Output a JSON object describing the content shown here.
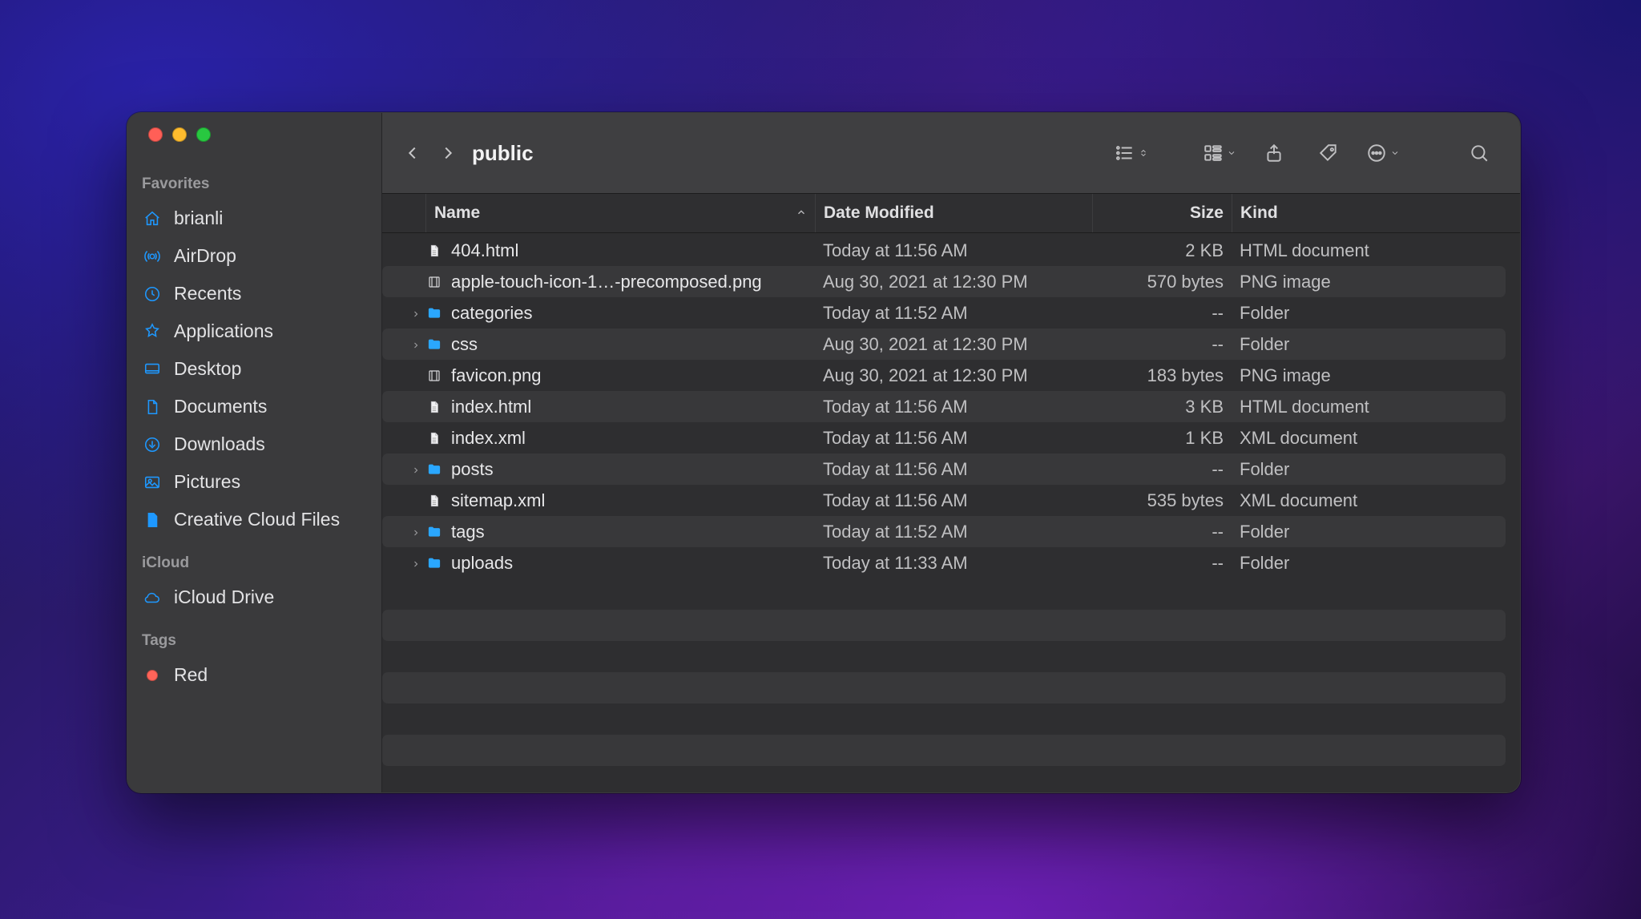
{
  "window": {
    "title": "public"
  },
  "sidebar": {
    "sections": [
      {
        "title": "Favorites",
        "items": [
          {
            "icon": "home",
            "label": "brianli"
          },
          {
            "icon": "airdrop",
            "label": "AirDrop"
          },
          {
            "icon": "clock",
            "label": "Recents"
          },
          {
            "icon": "apps",
            "label": "Applications"
          },
          {
            "icon": "desktop",
            "label": "Desktop"
          },
          {
            "icon": "doc",
            "label": "Documents"
          },
          {
            "icon": "download",
            "label": "Downloads"
          },
          {
            "icon": "pictures",
            "label": "Pictures"
          },
          {
            "icon": "file",
            "label": "Creative Cloud Files"
          }
        ]
      },
      {
        "title": "iCloud",
        "items": [
          {
            "icon": "cloud",
            "label": "iCloud Drive"
          }
        ]
      },
      {
        "title": "Tags",
        "items": [
          {
            "icon": "red-tag",
            "label": "Red"
          }
        ]
      }
    ]
  },
  "columns": {
    "name": "Name",
    "date": "Date Modified",
    "size": "Size",
    "kind": "Kind"
  },
  "files": [
    {
      "expandable": false,
      "type": "doc",
      "name": "404.html",
      "date": "Today at 11:56 AM",
      "size": "2 KB",
      "kind": "HTML document"
    },
    {
      "expandable": false,
      "type": "img",
      "name": "apple-touch-icon-1…-precomposed.png",
      "date": "Aug 30, 2021 at 12:30 PM",
      "size": "570 bytes",
      "kind": "PNG image"
    },
    {
      "expandable": true,
      "type": "folder",
      "name": "categories",
      "date": "Today at 11:52 AM",
      "size": "--",
      "kind": "Folder"
    },
    {
      "expandable": true,
      "type": "folder",
      "name": "css",
      "date": "Aug 30, 2021 at 12:30 PM",
      "size": "--",
      "kind": "Folder"
    },
    {
      "expandable": false,
      "type": "img",
      "name": "favicon.png",
      "date": "Aug 30, 2021 at 12:30 PM",
      "size": "183 bytes",
      "kind": "PNG image"
    },
    {
      "expandable": false,
      "type": "doc",
      "name": "index.html",
      "date": "Today at 11:56 AM",
      "size": "3 KB",
      "kind": "HTML document"
    },
    {
      "expandable": false,
      "type": "doc",
      "name": "index.xml",
      "date": "Today at 11:56 AM",
      "size": "1 KB",
      "kind": "XML document"
    },
    {
      "expandable": true,
      "type": "folder",
      "name": "posts",
      "date": "Today at 11:56 AM",
      "size": "--",
      "kind": "Folder"
    },
    {
      "expandable": false,
      "type": "doc",
      "name": "sitemap.xml",
      "date": "Today at 11:56 AM",
      "size": "535 bytes",
      "kind": "XML document"
    },
    {
      "expandable": true,
      "type": "folder",
      "name": "tags",
      "date": "Today at 11:52 AM",
      "size": "--",
      "kind": "Folder"
    },
    {
      "expandable": true,
      "type": "folder",
      "name": "uploads",
      "date": "Today at 11:33 AM",
      "size": "--",
      "kind": "Folder"
    }
  ]
}
